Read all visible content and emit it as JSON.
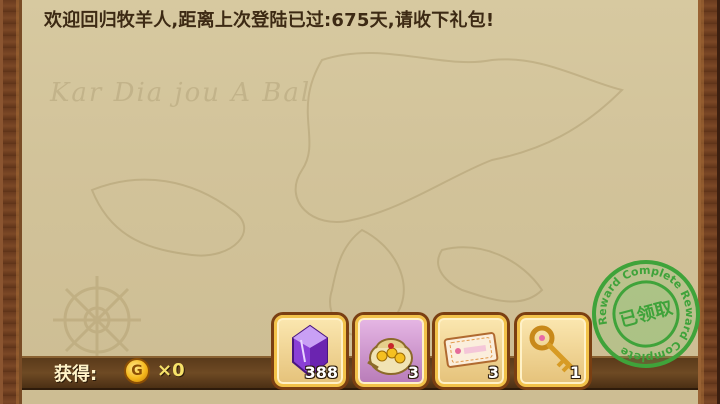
{
  "message": "欢迎回归牧羊人,距离上次登陆已过:675天,请收下礼包!",
  "map_script": "Kar Dia jou A Bal",
  "bottom": {
    "obtain_label": "获得:",
    "coin_symbol": "G",
    "coin_count": "×0"
  },
  "rewards": [
    {
      "name": "purple-crystal",
      "qty": "388"
    },
    {
      "name": "gold-bag",
      "qty": "3"
    },
    {
      "name": "ticket",
      "qty": "3"
    },
    {
      "name": "golden-key",
      "qty": "1"
    }
  ],
  "stamp": {
    "text": "已领取",
    "ring_text": "Reward Complete Reward Complete"
  },
  "colors": {
    "stamp": "#3fa33a",
    "slot_border": "#f2c24a",
    "selected_slot": "#b87bb8"
  }
}
